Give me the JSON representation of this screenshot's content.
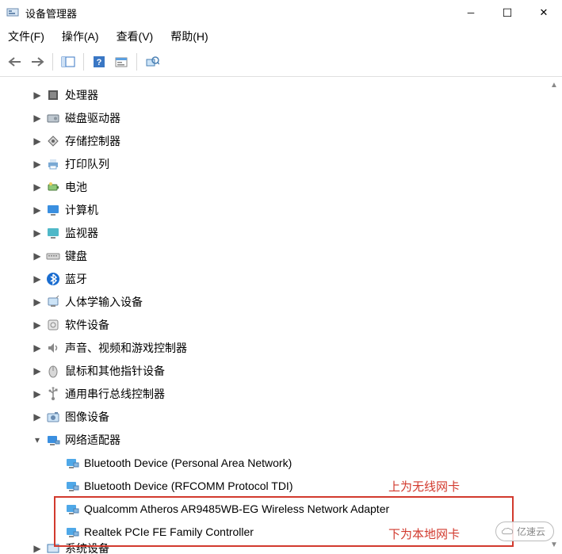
{
  "window": {
    "title": "设备管理器"
  },
  "menu": {
    "file": "文件(F)",
    "action": "操作(A)",
    "view": "查看(V)",
    "help": "帮助(H)"
  },
  "categories": [
    {
      "key": "cpu",
      "label": "处理器",
      "exp": "▶",
      "icon": "cpu"
    },
    {
      "key": "disk",
      "label": "磁盘驱动器",
      "exp": "▶",
      "icon": "disk"
    },
    {
      "key": "storage",
      "label": "存储控制器",
      "exp": "▶",
      "icon": "storage"
    },
    {
      "key": "printq",
      "label": "打印队列",
      "exp": "▶",
      "icon": "printer"
    },
    {
      "key": "battery",
      "label": "电池",
      "exp": "▶",
      "icon": "battery"
    },
    {
      "key": "computer",
      "label": "计算机",
      "exp": "▶",
      "icon": "monitor-blue"
    },
    {
      "key": "monitor",
      "label": "监视器",
      "exp": "▶",
      "icon": "monitor-teal"
    },
    {
      "key": "keyboard",
      "label": "键盘",
      "exp": "▶",
      "icon": "keyboard"
    },
    {
      "key": "bt",
      "label": "蓝牙",
      "exp": "▶",
      "icon": "bluetooth"
    },
    {
      "key": "hid",
      "label": "人体学输入设备",
      "exp": "▶",
      "icon": "hid"
    },
    {
      "key": "soft",
      "label": "软件设备",
      "exp": "▶",
      "icon": "software"
    },
    {
      "key": "sound",
      "label": "声音、视频和游戏控制器",
      "exp": "▶",
      "icon": "speaker"
    },
    {
      "key": "mouse",
      "label": "鼠标和其他指针设备",
      "exp": "▶",
      "icon": "mouse"
    },
    {
      "key": "usb",
      "label": "通用串行总线控制器",
      "exp": "▶",
      "icon": "usb"
    },
    {
      "key": "image",
      "label": "图像设备",
      "exp": "▶",
      "icon": "camera"
    },
    {
      "key": "net",
      "label": "网络适配器",
      "exp": "▾",
      "icon": "network"
    }
  ],
  "network_devices": [
    {
      "label": "Bluetooth Device (Personal Area Network)"
    },
    {
      "label": "Bluetooth Device (RFCOMM Protocol TDI)"
    },
    {
      "label": "Qualcomm Atheros AR9485WB-EG Wireless Network Adapter"
    },
    {
      "label": "Realtek PCIe FE Family Controller"
    }
  ],
  "truncated": {
    "label": "系统设备",
    "exp": "▶"
  },
  "annotations": {
    "top": "上为无线网卡",
    "bottom": "下为本地网卡"
  },
  "watermark": "亿速云"
}
